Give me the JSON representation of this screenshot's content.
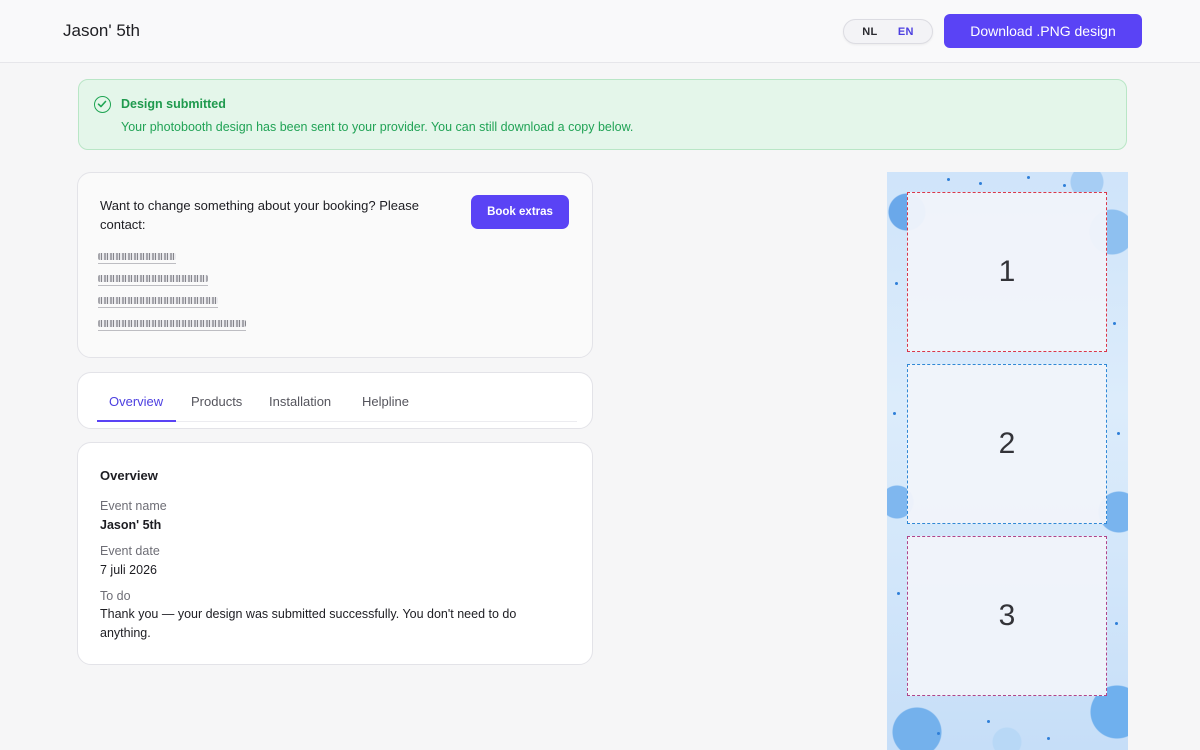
{
  "header": {
    "title": "Jason' 5th",
    "lang_nl": "NL",
    "lang_en": "EN",
    "download_label": "Download .PNG design"
  },
  "alert": {
    "title": "Design submitted",
    "text": "Your photobooth design has been sent to your provider. You can still download a copy below."
  },
  "contact": {
    "text": "Want to change something about your booking? Please contact:",
    "book_extras_label": "Book extras"
  },
  "tabs": [
    {
      "label": "Overview",
      "active": true
    },
    {
      "label": "Products",
      "active": false
    },
    {
      "label": "Installation",
      "active": false
    },
    {
      "label": "Helpline",
      "active": false
    }
  ],
  "overview": {
    "heading": "Overview",
    "event_name_label": "Event name",
    "event_name_value": "Jason' 5th",
    "event_date_label": "Event date",
    "event_date_value": "7 juli 2026",
    "todo_label": "To do",
    "todo_value": "Thank you — your design was submitted successfully. You don't need to do anything."
  },
  "photo_strip": {
    "frames": [
      "1",
      "2",
      "3"
    ]
  },
  "colors": {
    "accent": "#5a43f5",
    "success_bg": "#e4f6ea",
    "success_text": "#1f9a4e"
  }
}
